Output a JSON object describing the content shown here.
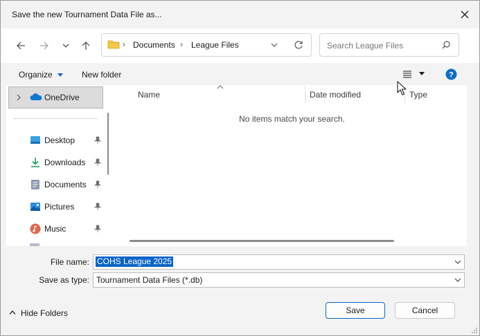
{
  "window": {
    "title": "Save the new Tournament Data File as..."
  },
  "address": {
    "folder_icon": "folder-icon",
    "breadcrumbs": [
      "Documents",
      "League Files"
    ],
    "search_placeholder": "Search League Files"
  },
  "toolbar": {
    "organize_label": "Organize",
    "new_folder_label": "New folder",
    "view_icon": "list-view-icon",
    "help_icon": "help-icon"
  },
  "nav": {
    "onedrive_label": "OneDrive",
    "items": [
      {
        "label": "Desktop",
        "icon": "desktop-icon",
        "pinned": true
      },
      {
        "label": "Downloads",
        "icon": "download-icon",
        "pinned": true
      },
      {
        "label": "Documents",
        "icon": "documents-icon",
        "pinned": true
      },
      {
        "label": "Pictures",
        "icon": "pictures-icon",
        "pinned": true
      },
      {
        "label": "Music",
        "icon": "music-icon",
        "pinned": true
      }
    ]
  },
  "file_list": {
    "columns": [
      "Name",
      "Date modified",
      "Type"
    ],
    "empty_message": "No items match your search."
  },
  "form": {
    "file_name_label": "File name:",
    "file_name_value": "COHS League 2025",
    "save_as_type_label": "Save as type:",
    "save_as_type_value": "Tournament Data Files (*.db)"
  },
  "footer": {
    "hide_folders_label": "Hide Folders",
    "save_label": "Save",
    "cancel_label": "Cancel"
  },
  "colors": {
    "accent": "#0a64c8",
    "onedrive_blue": "#0f78d4",
    "folder_yellow": "#f2c94c",
    "selection_bg": "#0a64c8"
  }
}
